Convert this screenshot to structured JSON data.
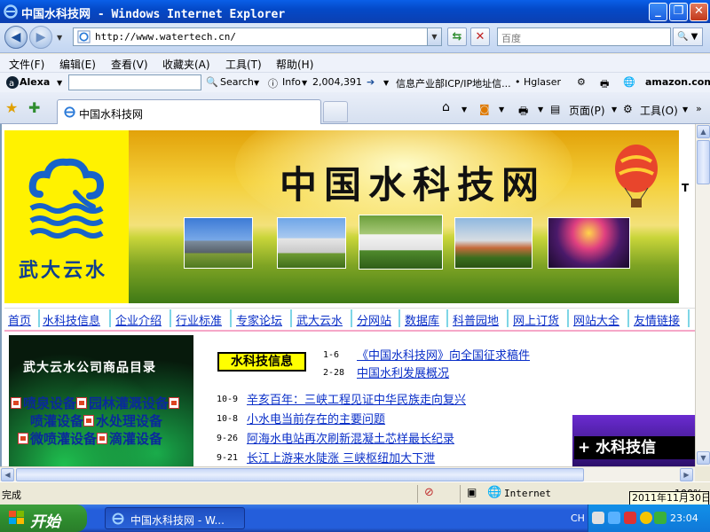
{
  "window": {
    "title": "中国水科技网 - Windows Internet Explorer",
    "minimize_glyph": "_",
    "maximize_glyph": "❐",
    "close_glyph": "✕"
  },
  "address_bar": {
    "url": "http://www.watertech.cn/",
    "search_placeholder": "百度"
  },
  "menu": [
    "文件(F)",
    "编辑(E)",
    "查看(V)",
    "收藏夹(A)",
    "工具(T)",
    "帮助(H)"
  ],
  "alexa_bar": {
    "brand": "Alexa",
    "search_label": "Search",
    "info_label": "Info",
    "rank": "2,004,391",
    "site_info": "信息产业部ICP/IP地址信...",
    "hglaser": "• Hglaser",
    "amazon": "amazon.com."
  },
  "tab": {
    "label": "中国水科技网"
  },
  "command_bar": {
    "page_label": "页面(P)",
    "tools_label": "工具(O)"
  },
  "banner": {
    "logo_text": "武大云水",
    "site_title": "中国水科技网",
    "edge_text": "T"
  },
  "nav_links": [
    "首页",
    "水科技信息",
    "企业介绍",
    "行业标准",
    "专家论坛",
    "武大云水",
    "分网站",
    "数据库",
    "科普园地",
    "网上订货",
    "网站大全",
    "友情链接"
  ],
  "product_box": {
    "title": "武大云水公司商品目录",
    "items": [
      "喷泉设备",
      "园林灌溉设备",
      "喷灌设备",
      "水处理设备",
      "微喷灌设备",
      "滴灌设备"
    ]
  },
  "news_section": {
    "heading": "水科技信息",
    "top_items": [
      {
        "date": "1-6",
        "title": "《中国水科技网》向全国征求稿件"
      },
      {
        "date": "2-28",
        "title": "中国水利发展概况"
      }
    ],
    "items": [
      {
        "date": "10-9",
        "title": "辛亥百年：三峡工程见证中华民族走向复兴"
      },
      {
        "date": "10-8",
        "title": "小水电当前存在的主要问题 "
      },
      {
        "date": "9-26",
        "title": "阿海水电站再次刷新混凝土芯样最长纪录"
      },
      {
        "date": "9-21",
        "title": "长江上游来水陡涨 三峡枢纽加大下泄"
      }
    ],
    "ad_text": "水科技信"
  },
  "status_bar": {
    "status": "完成",
    "zone": "Internet",
    "zoom": "100%",
    "tooltip_date": "2011年11月30日"
  },
  "taskbar": {
    "start_label": "开始",
    "window_item": "中国水科技网 - W...",
    "lang": "CH",
    "clock": "23:04"
  },
  "colors": {
    "title_blue": "#0449c8",
    "banner_yellow": "#fff200",
    "link_blue": "#0a2fc8",
    "news_head_bg": "#ffff00",
    "start_green": "#2f8d2f"
  }
}
